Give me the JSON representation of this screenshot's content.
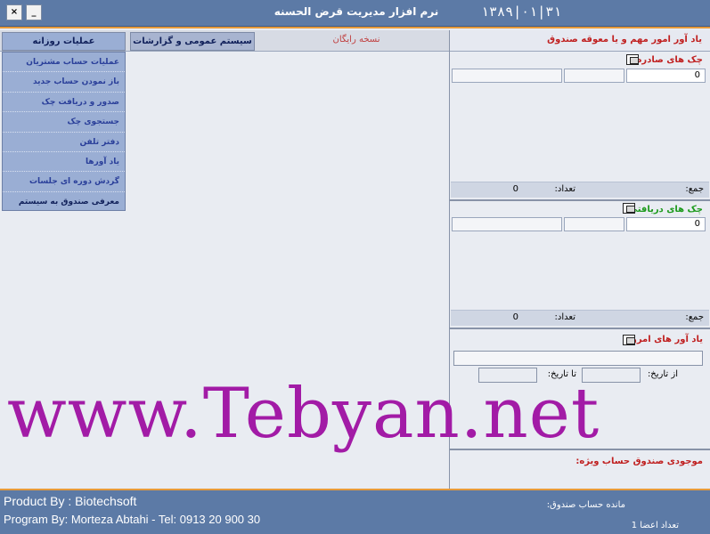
{
  "window": {
    "title": "نرم افزار مديريت قرض الحسنه",
    "date": "۱۳۸۹|۰۱|۳۱",
    "close_label": "×",
    "min_label": "_"
  },
  "tabs": {
    "daily": "عمليات روزانه",
    "general": "سيستم عمومی و گزارشات",
    "edition": "نسخه رايگان"
  },
  "menu": {
    "items": [
      "عمليات حساب مشتريان",
      "باز نمودن حساب جديد",
      "صدور و دريافت چک",
      "جستجوی چک",
      "دفتر تلفن",
      "ياد آورها",
      "گردش دوره ای جلسات",
      "معرفی صندوق به سيستم"
    ]
  },
  "right_panel": {
    "header": "ياد آور امور مهم و يا معوقه صندوق",
    "issued": {
      "title": "چک های صادره :",
      "value": "0",
      "sum_label": "جمع:",
      "count_label": "تعداد:",
      "count_value": "0"
    },
    "received": {
      "title": "چک های دريافتی :",
      "value": "0",
      "sum_label": "جمع:",
      "count_label": "تعداد:",
      "count_value": "0"
    },
    "reminders": {
      "title": "ياد آور های امروز:",
      "from_label": "از تاريخ:",
      "to_label": "تا تاريخ:"
    },
    "special": {
      "title": "موجودی صندوق حساب ويژه:"
    }
  },
  "watermark": "www.Tebyan.net",
  "footer": {
    "product": "Product By : Biotechsoft",
    "program": "Program By: Morteza Abtahi - Tel: 0913 20 900 30",
    "balance_label": "مانده حساب صندوق:",
    "members": "تعداد اعضا 1"
  },
  "colors": {
    "titlebar": "#5c7aa6",
    "accent": "#e79a3a",
    "menu_bg": "#9aaed4",
    "watermark": "#a21ba6"
  }
}
